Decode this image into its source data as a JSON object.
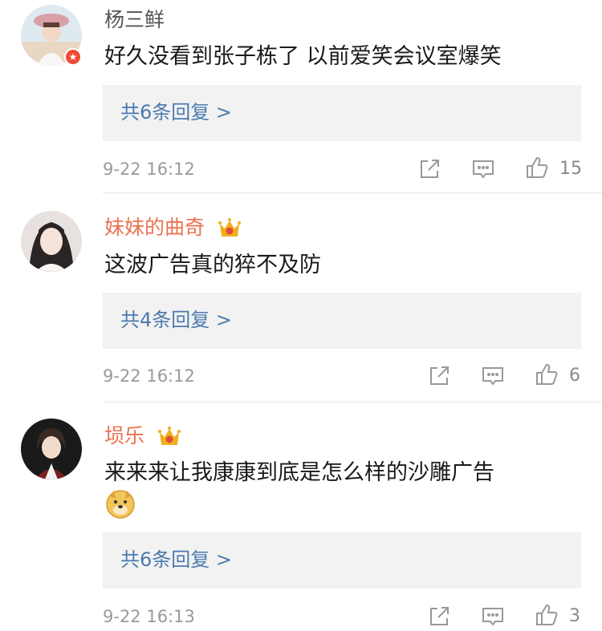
{
  "comments": [
    {
      "username": "杨三鲜",
      "text": "好久没看到张子栋了 以前爱笑会议室爆笑",
      "replies_label": "共6条回复 >",
      "time": "9-22 16:12",
      "likes": "15",
      "name_color": "#555555",
      "avatar_icon": "avatar-girl-hat"
    },
    {
      "username": "妹妹的曲奇",
      "text": "这波广告真的猝不及防",
      "replies_label": "共4条回复 >",
      "time": "9-22 16:12",
      "likes": "6",
      "name_color": "#eb7350",
      "avatar_icon": "avatar-girl-dark-hair"
    },
    {
      "username": "埙乐",
      "text": "来来来让我康康到底是怎么样的沙雕广告",
      "replies_label": "共6条回复 >",
      "time": "9-22 16:13",
      "likes": "3",
      "name_color": "#eb7350",
      "avatar_icon": "avatar-anime-boy"
    }
  ],
  "icons": {
    "share": "share-icon",
    "comment": "comment-icon",
    "like": "thumbs-up-icon",
    "crown": "crown-badge-icon",
    "verified": "verified-badge-icon",
    "doge": "doge-emoji-icon"
  },
  "colors": {
    "link": "#4a7ab0",
    "vip_name": "#eb7350",
    "reply_bg": "#f2f2f2",
    "time": "#9a9a9a"
  }
}
